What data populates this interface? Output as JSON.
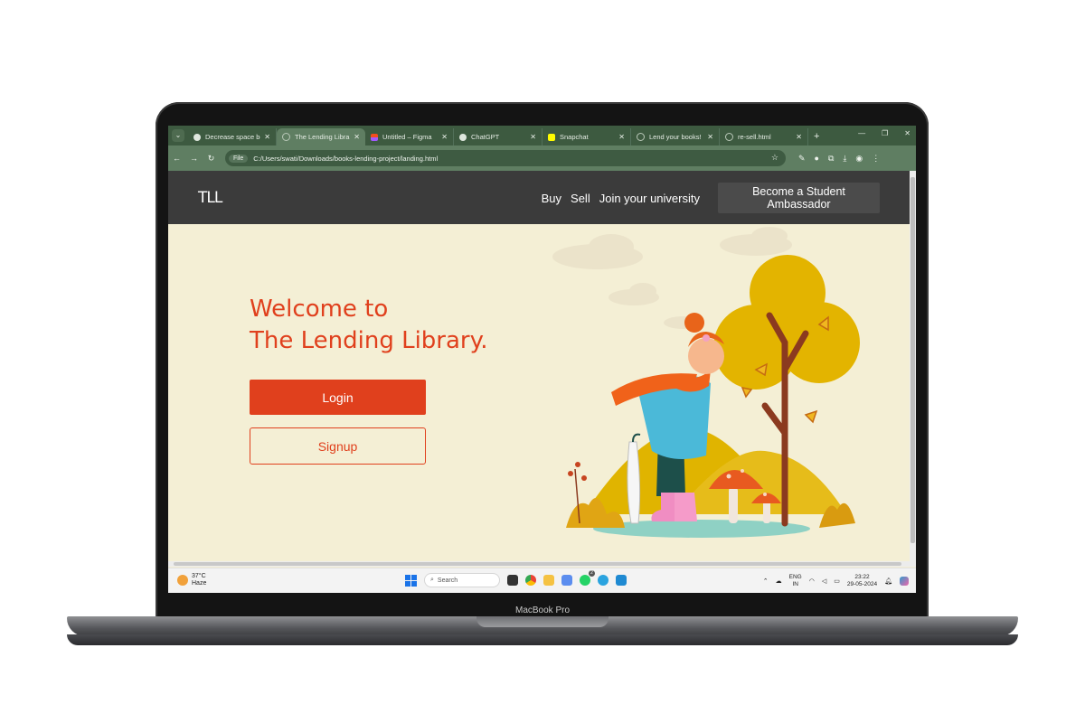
{
  "device": {
    "label": "MacBook Pro"
  },
  "browser": {
    "tabs": [
      {
        "title": "Decrease space betw",
        "icon": "chatgpt-icon"
      },
      {
        "title": "The Lending Library",
        "icon": "globe-icon",
        "active": true
      },
      {
        "title": "Untitled – Figma",
        "icon": "figma-icon"
      },
      {
        "title": "ChatGPT",
        "icon": "chatgpt-icon"
      },
      {
        "title": "Snapchat",
        "icon": "snapchat-icon"
      },
      {
        "title": "Lend your books!",
        "icon": "globe-icon"
      },
      {
        "title": "re-sell.html",
        "icon": "globe-icon"
      }
    ],
    "file_chip": "File",
    "url": "C:/Users/swati/Downloads/books-lending-project/landing.html"
  },
  "page": {
    "logo": "TLL",
    "nav": {
      "buy": "Buy",
      "sell": "Sell",
      "join": "Join your university"
    },
    "ambassador_label": "Become a Student Ambassador",
    "hero": {
      "line1": "Welcome to",
      "line2": "The Lending Library."
    },
    "login_label": "Login",
    "signup_label": "Signup"
  },
  "taskbar": {
    "temperature": "37°C",
    "condition": "Haze",
    "search_placeholder": "Search",
    "language_line1": "ENG",
    "language_line2": "IN",
    "time": "23:22",
    "date": "29-05-2024",
    "notification_count": "2"
  },
  "colors": {
    "accent": "#e0401d",
    "navbar": "#3b3b3b",
    "page_bg": "#f4efd5",
    "browser_chrome": "#5f7e62"
  }
}
